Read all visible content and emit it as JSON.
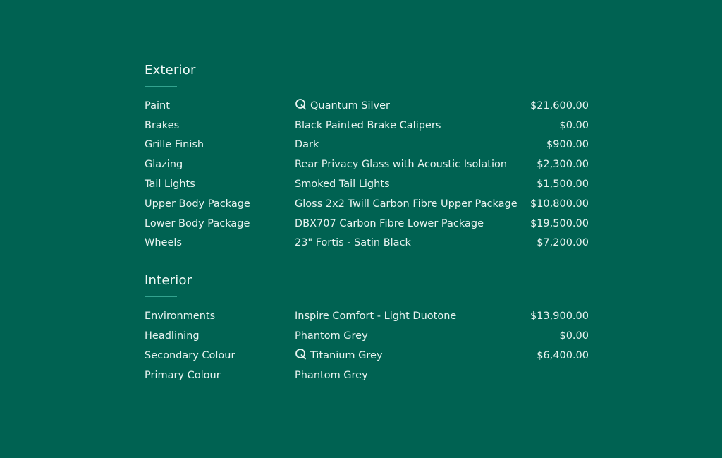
{
  "sections": [
    {
      "title": "Exterior",
      "rows": [
        {
          "label": "Paint",
          "option": "Quantum Silver",
          "price": "$21,600.00",
          "icon": "q-icon"
        },
        {
          "label": "Brakes",
          "option": "Black Painted Brake Calipers",
          "price": "$0.00",
          "icon": ""
        },
        {
          "label": "Grille Finish",
          "option": "Dark",
          "price": "$900.00",
          "icon": ""
        },
        {
          "label": "Glazing",
          "option": "Rear Privacy Glass with Acoustic Isolation",
          "price": "$2,300.00",
          "icon": ""
        },
        {
          "label": "Tail Lights",
          "option": "Smoked Tail Lights",
          "price": "$1,500.00",
          "icon": ""
        },
        {
          "label": "Upper Body Package",
          "option": "Gloss 2x2 Twill Carbon Fibre Upper Package",
          "price": "$10,800.00",
          "icon": ""
        },
        {
          "label": "Lower Body Package",
          "option": "DBX707 Carbon Fibre Lower Package",
          "price": "$19,500.00",
          "icon": ""
        },
        {
          "label": "Wheels",
          "option": "23\" Fortis - Satin Black",
          "price": "$7,200.00",
          "icon": ""
        }
      ]
    },
    {
      "title": "Interior",
      "rows": [
        {
          "label": "Environments",
          "option": "Inspire Comfort - Light Duotone",
          "price": "$13,900.00",
          "icon": ""
        },
        {
          "label": "Headlining",
          "option": "Phantom Grey",
          "price": "$0.00",
          "icon": ""
        },
        {
          "label": "Secondary Colour",
          "option": "Titanium Grey",
          "price": "$6,400.00",
          "icon": "q-icon"
        },
        {
          "label": "Primary Colour",
          "option": "Phantom Grey",
          "price": "",
          "icon": ""
        }
      ]
    }
  ],
  "colors": {
    "background": "#006252",
    "text": "#e8f3f0",
    "rule": "#33a38f"
  }
}
